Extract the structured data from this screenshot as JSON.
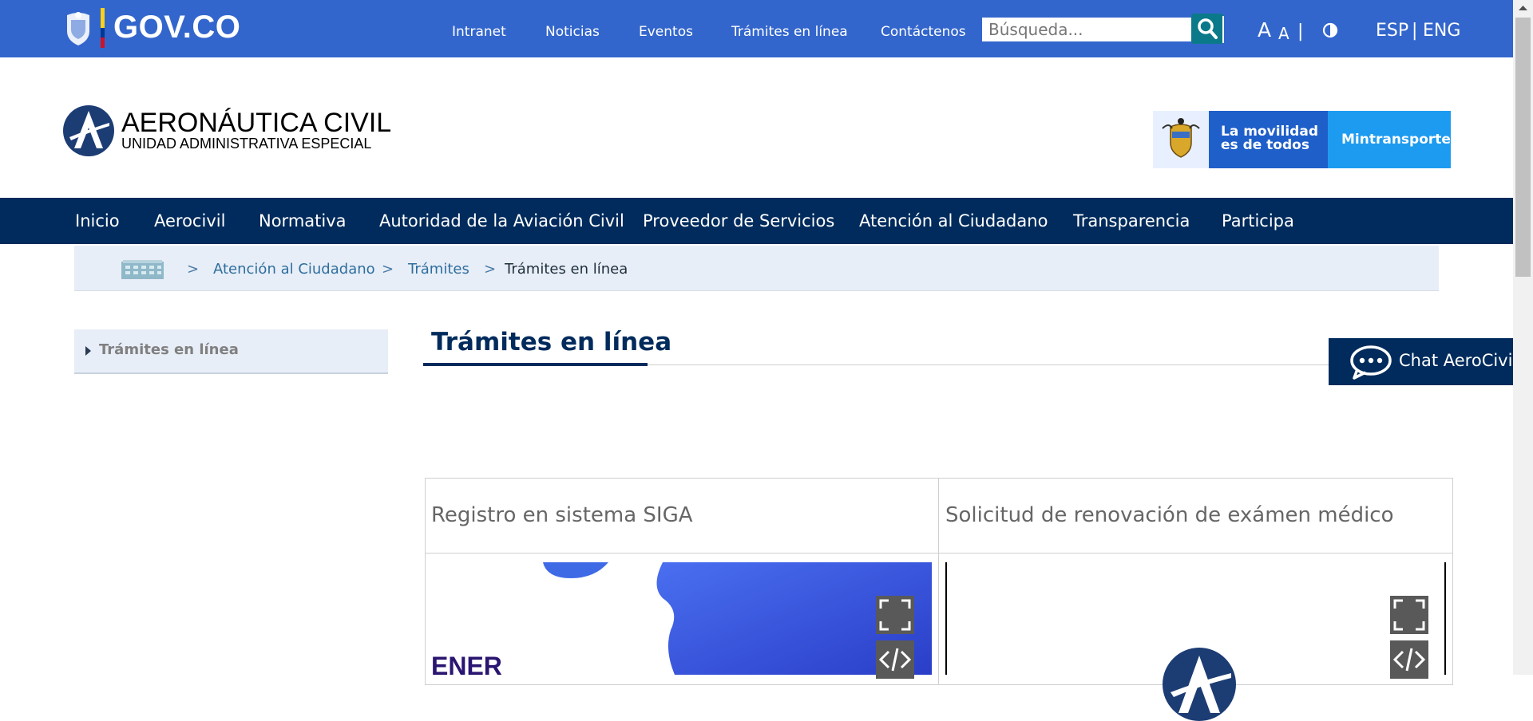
{
  "gov_bar": {
    "brand": "GOV.CO",
    "links": [
      "Intranet",
      "Noticias",
      "Eventos",
      "Trámites en línea",
      "Contáctenos"
    ],
    "search_placeholder": "Búsqueda...",
    "font_large": "A",
    "font_small": "A",
    "separator": "|",
    "lang_esp": "ESP",
    "lang_sep": "|",
    "lang_eng": "ENG"
  },
  "header": {
    "title": "AERONÁUTICA CIVIL",
    "subtitle": "UNIDAD ADMINISTRATIVA ESPECIAL",
    "banner_slogan": "La movilidad es de todos",
    "banner_brand": "Mintransporte"
  },
  "main_nav": [
    "Inicio",
    "Aerocivil",
    "Normativa",
    "Autoridad de la Aviación Civil",
    "Proveedor de Servicios",
    "Atención al Ciudadano",
    "Transparencia",
    "Participa"
  ],
  "breadcrumb": {
    "separator": ">",
    "items": [
      "Atención al Ciudadano",
      "Trámites"
    ],
    "current": "Trámites en línea"
  },
  "sidebar": {
    "items": [
      "Trámites en línea"
    ]
  },
  "page": {
    "title": "Trámites en línea"
  },
  "chat": {
    "label": "Chat AeroCivil"
  },
  "table": {
    "headers": [
      "Registro en sistema SIGA",
      "Solicitud de renovación  de exámen médico"
    ],
    "card1_text": "ENER"
  },
  "colors": {
    "gov_blue": "#3366cc",
    "navy": "#002b5c",
    "breadcrumb_bg": "#e8eef7"
  }
}
